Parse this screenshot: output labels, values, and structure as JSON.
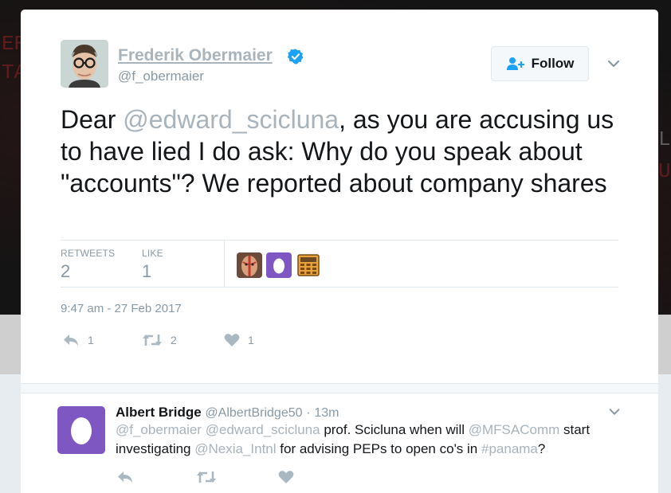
{
  "background": {
    "left_letters_line1": "ER",
    "left_letters_line2": "TA",
    "right_letters_line1": "L",
    "right_letters_line2": "U"
  },
  "tweet": {
    "author_name": "Frederik Obermaier",
    "author_handle": "@f_obermaier",
    "verified": true,
    "follow_label": "Follow",
    "text_before": "Dear ",
    "mention": "@edward_scicluna",
    "text_after": ", as you are accusing us to have lied I do ask: Why do you speak about \"accounts\"? We reported about company shares",
    "retweets_label": "RETWEETS",
    "retweets_count": "2",
    "likes_label": "LIKE",
    "likes_count": "1",
    "timestamp": "9:47 am - 27 Feb 2017",
    "actions": {
      "reply_count": "1",
      "retweet_count": "2",
      "like_count": "1"
    }
  },
  "reply": {
    "author_name": "Albert Bridge",
    "author_handle": "@AlbertBridge50",
    "dot": "·",
    "time": "13m",
    "m1": "@f_obermaier",
    "sp1": " ",
    "m2": "@edward_scicluna",
    "t1": " prof. Scicluna when will ",
    "m3": "@MFSAComm",
    "t2": " start investigating ",
    "m4": "@Nexia_Intnl",
    "t3": " for advising PEPs to open co's in ",
    "m5": "#panama",
    "t4": "?"
  },
  "colors": {
    "accent": "#1da1f2",
    "muted": "#8899a6",
    "mention": "#a8b3bc",
    "egg_purple": "#7e57c2"
  },
  "icons": [
    "verified-icon",
    "follow-user-icon",
    "chevron-down-icon",
    "reply-icon",
    "retweet-icon",
    "heart-icon",
    "egg-icon"
  ]
}
